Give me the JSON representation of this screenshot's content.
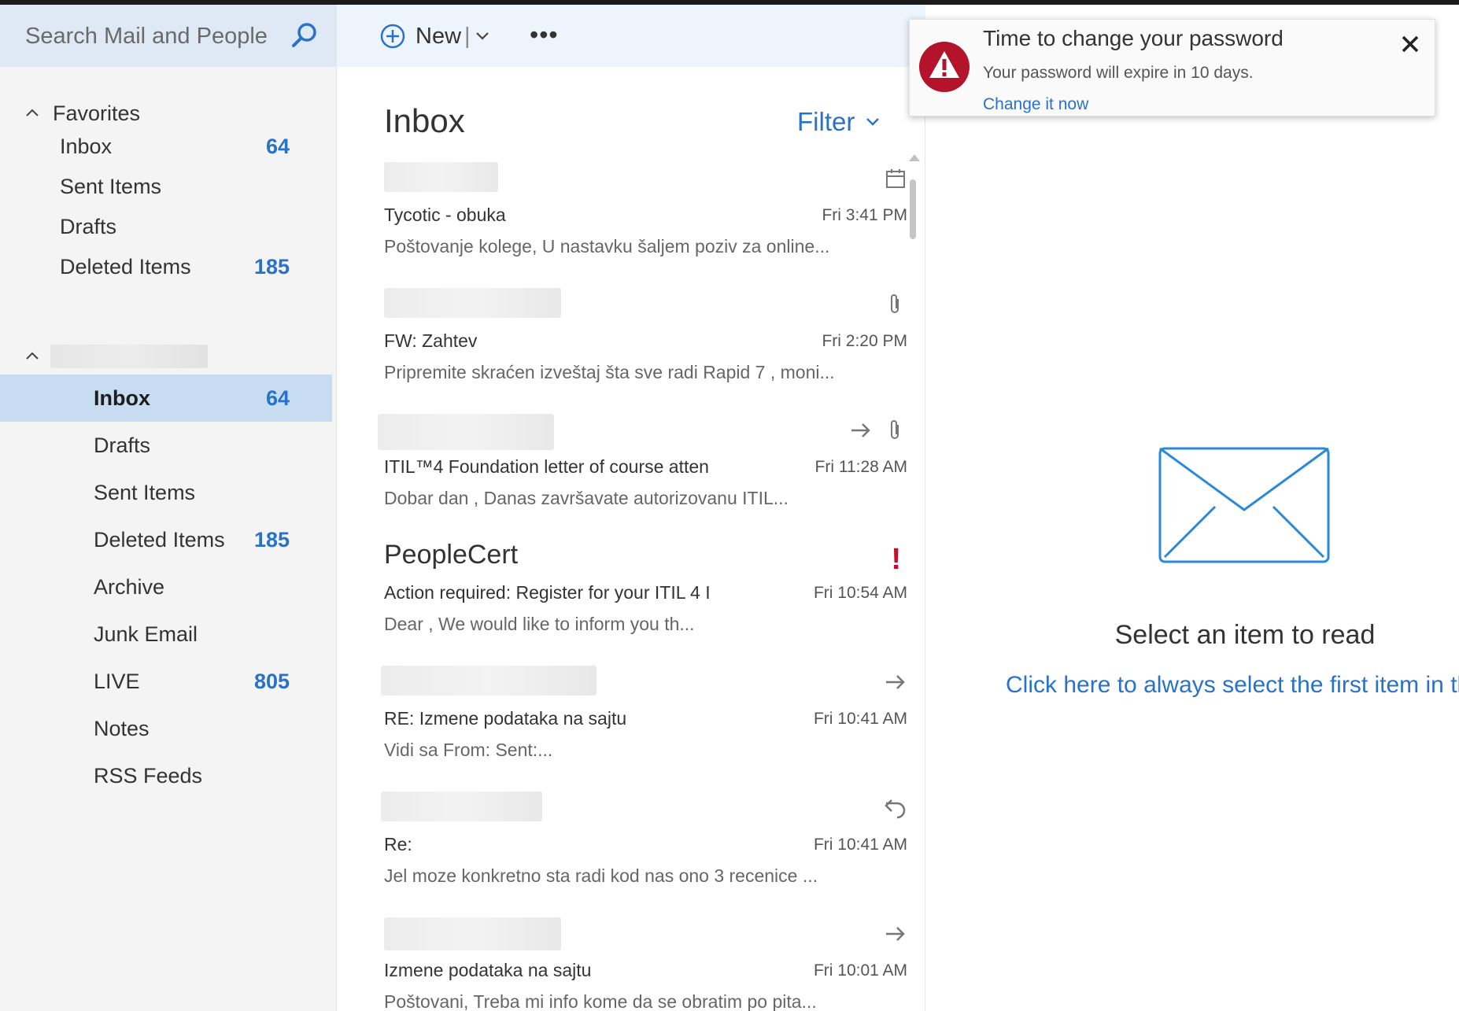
{
  "search": {
    "placeholder": "Search Mail and People"
  },
  "toolbar": {
    "new_label": "New",
    "separator": "|",
    "more": "•••"
  },
  "favorites": {
    "label": "Favorites",
    "items": [
      {
        "label": "Inbox",
        "count": "64"
      },
      {
        "label": "Sent Items",
        "count": ""
      },
      {
        "label": "Drafts",
        "count": ""
      },
      {
        "label": "Deleted Items",
        "count": "185"
      }
    ]
  },
  "account": {
    "items": [
      {
        "label": "Inbox",
        "count": "64"
      },
      {
        "label": "Drafts",
        "count": ""
      },
      {
        "label": "Sent Items",
        "count": ""
      },
      {
        "label": "Deleted Items",
        "count": "185"
      },
      {
        "label": "Archive",
        "count": ""
      },
      {
        "label": "Junk Email",
        "count": ""
      },
      {
        "label": "LIVE",
        "count": "805"
      },
      {
        "label": "Notes",
        "count": ""
      },
      {
        "label": "RSS Feeds",
        "count": ""
      }
    ]
  },
  "list": {
    "title": "Inbox",
    "filter_label": "Filter",
    "messages": [
      {
        "sender": "",
        "subject": "Tycotic - obuka",
        "time": "Fri 3:41 PM",
        "preview": "Poštovanje kolege, U nastavku šaljem poziv za online...",
        "icons": [
          "calendar-icon"
        ]
      },
      {
        "sender": "",
        "subject": "FW: Zahtev",
        "time": "Fri 2:20 PM",
        "preview": "Pripremite skraćen izveštaj šta sve radi Rapid 7 , moni...",
        "icons": [
          "attachment-icon"
        ]
      },
      {
        "sender": "",
        "subject": "ITIL™4 Foundation letter of course atten",
        "time": "Fri 11:28 AM",
        "preview": "Dobar dan , Danas završavate autorizovanu ITIL...",
        "icons": [
          "forward-icon",
          "attachment-icon"
        ]
      },
      {
        "sender": "PeopleCert",
        "subject": "Action required: Register for your ITIL 4 I",
        "time": "Fri 10:54 AM",
        "preview": "Dear , We would like to inform you th...",
        "icons": [
          "importance-icon"
        ]
      },
      {
        "sender": "",
        "subject": "RE: Izmene podataka na sajtu",
        "time": "Fri 10:41 AM",
        "preview": "Vidi sa From: Sent:...",
        "icons": [
          "forward-icon"
        ]
      },
      {
        "sender": "",
        "subject": "Re:",
        "time": "Fri 10:41 AM",
        "preview": "Jel moze konkretno sta radi kod nas ono 3 recenice ...",
        "icons": [
          "reply-icon"
        ]
      },
      {
        "sender": "",
        "subject": "Izmene podataka na sajtu",
        "time": "Fri 10:01 AM",
        "preview": "Poštovani, Treba mi info kome da se obratim po pita...",
        "icons": [
          "forward-icon"
        ]
      }
    ]
  },
  "reading": {
    "empty_text": "Select an item to read",
    "link_text": "Click here to always select the first item in the l"
  },
  "notification": {
    "title": "Time to change your password",
    "body": "Your password will expire in 10 days.",
    "link": "Change it now"
  },
  "colors": {
    "accent": "#2a72c8",
    "selected": "#c7dcf1",
    "warning": "#b3132b"
  }
}
